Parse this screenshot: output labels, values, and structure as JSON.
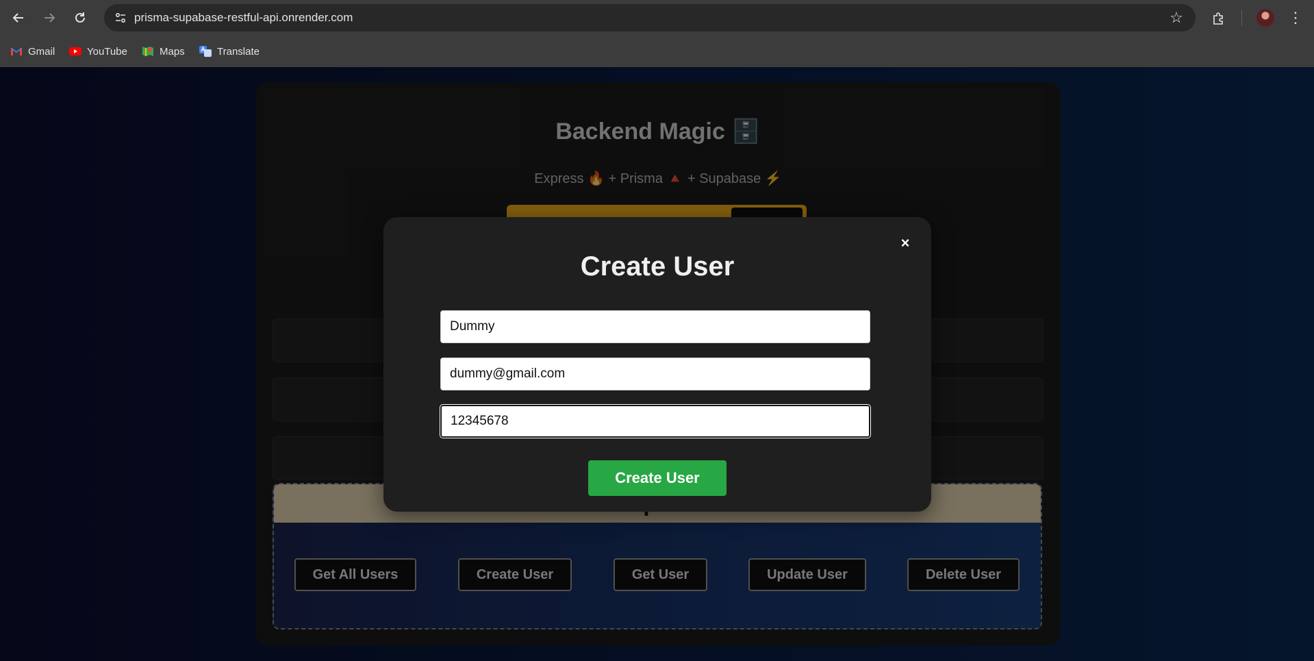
{
  "browser": {
    "url": "prisma-supabase-restful-api.onrender.com",
    "bookmarks": [
      {
        "label": "Gmail",
        "icon": "gmail-icon"
      },
      {
        "label": "YouTube",
        "icon": "youtube-icon"
      },
      {
        "label": "Maps",
        "icon": "maps-icon"
      },
      {
        "label": "Translate",
        "icon": "translate-icon"
      }
    ]
  },
  "app": {
    "title": "Backend Magic 🗄️",
    "subtitle": "Express 🔥 + Prisma 🔺 + Supabase ⚡",
    "operations": {
      "header": "User Operations",
      "buttons": [
        "Get All Users",
        "Create User",
        "Get User",
        "Update User",
        "Delete User"
      ]
    }
  },
  "modal": {
    "title": "Create User",
    "close_label": "×",
    "fields": {
      "name": "Dummy",
      "email": "dummy@gmail.com",
      "password": "12345678"
    },
    "submit_label": "Create User"
  },
  "colors": {
    "submit": "#28a745",
    "banner": "#f6b21b",
    "ops_header": "#e8d6b3"
  }
}
